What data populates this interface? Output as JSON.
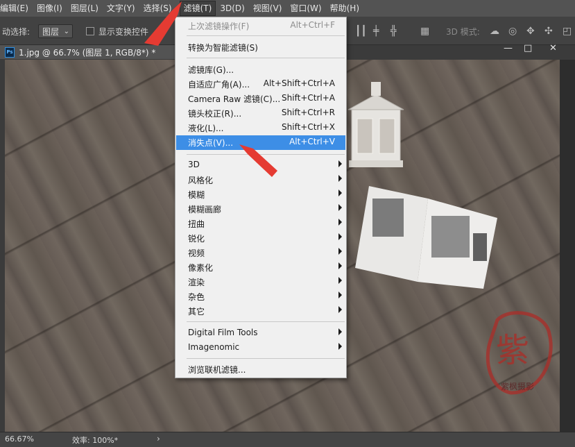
{
  "menubar": {
    "items": [
      {
        "label": "编辑(E)"
      },
      {
        "label": "图像(I)"
      },
      {
        "label": "图层(L)"
      },
      {
        "label": "文字(Y)"
      },
      {
        "label": "选择(S)"
      },
      {
        "label": "滤镜(T)",
        "active": true
      },
      {
        "label": "3D(D)"
      },
      {
        "label": "视图(V)"
      },
      {
        "label": "窗口(W)"
      },
      {
        "label": "帮助(H)"
      }
    ]
  },
  "options": {
    "auto_select_label": "动选择:",
    "layer_select": "图层",
    "show_transform": "显示变换控件",
    "mode_3d": "3D 模式:"
  },
  "document": {
    "tab_title": "1.jpg @ 66.7% (图层 1, RGB/8*) *",
    "ps_badge": "Ps"
  },
  "window_controls": {
    "minimize": "—",
    "maximize": "□",
    "close": "✕"
  },
  "filter_menu": {
    "last_filter": "上次滤镜操作(F)",
    "last_filter_shortcut": "Alt+Ctrl+F",
    "convert_smart": "转换为智能滤镜(S)",
    "gallery": "滤镜库(G)...",
    "adaptive": "自适应广角(A)...",
    "adaptive_shortcut": "Alt+Shift+Ctrl+A",
    "camera_raw": "Camera Raw 滤镜(C)...",
    "camera_raw_shortcut": "Shift+Ctrl+A",
    "lens": "镜头校正(R)...",
    "lens_shortcut": "Shift+Ctrl+R",
    "liquify": "液化(L)...",
    "liquify_shortcut": "Shift+Ctrl+X",
    "vanishing": "消失点(V)...",
    "vanishing_shortcut": "Alt+Ctrl+V",
    "submenus": [
      "3D",
      "风格化",
      "模糊",
      "模糊画廊",
      "扭曲",
      "锐化",
      "视频",
      "像素化",
      "渲染",
      "杂色",
      "其它"
    ],
    "plugins": [
      "Digital Film Tools",
      "Imagenomic"
    ],
    "browse": "浏览联机滤镜..."
  },
  "status": {
    "zoom": "66.67%",
    "efficiency": "效率: 100%*",
    "arrow": "›"
  },
  "watermark": {
    "char": "紫",
    "sub": "紫枫摄影"
  },
  "colors": {
    "highlight": "#3d8ee6",
    "arrow_red": "#e53b32"
  }
}
